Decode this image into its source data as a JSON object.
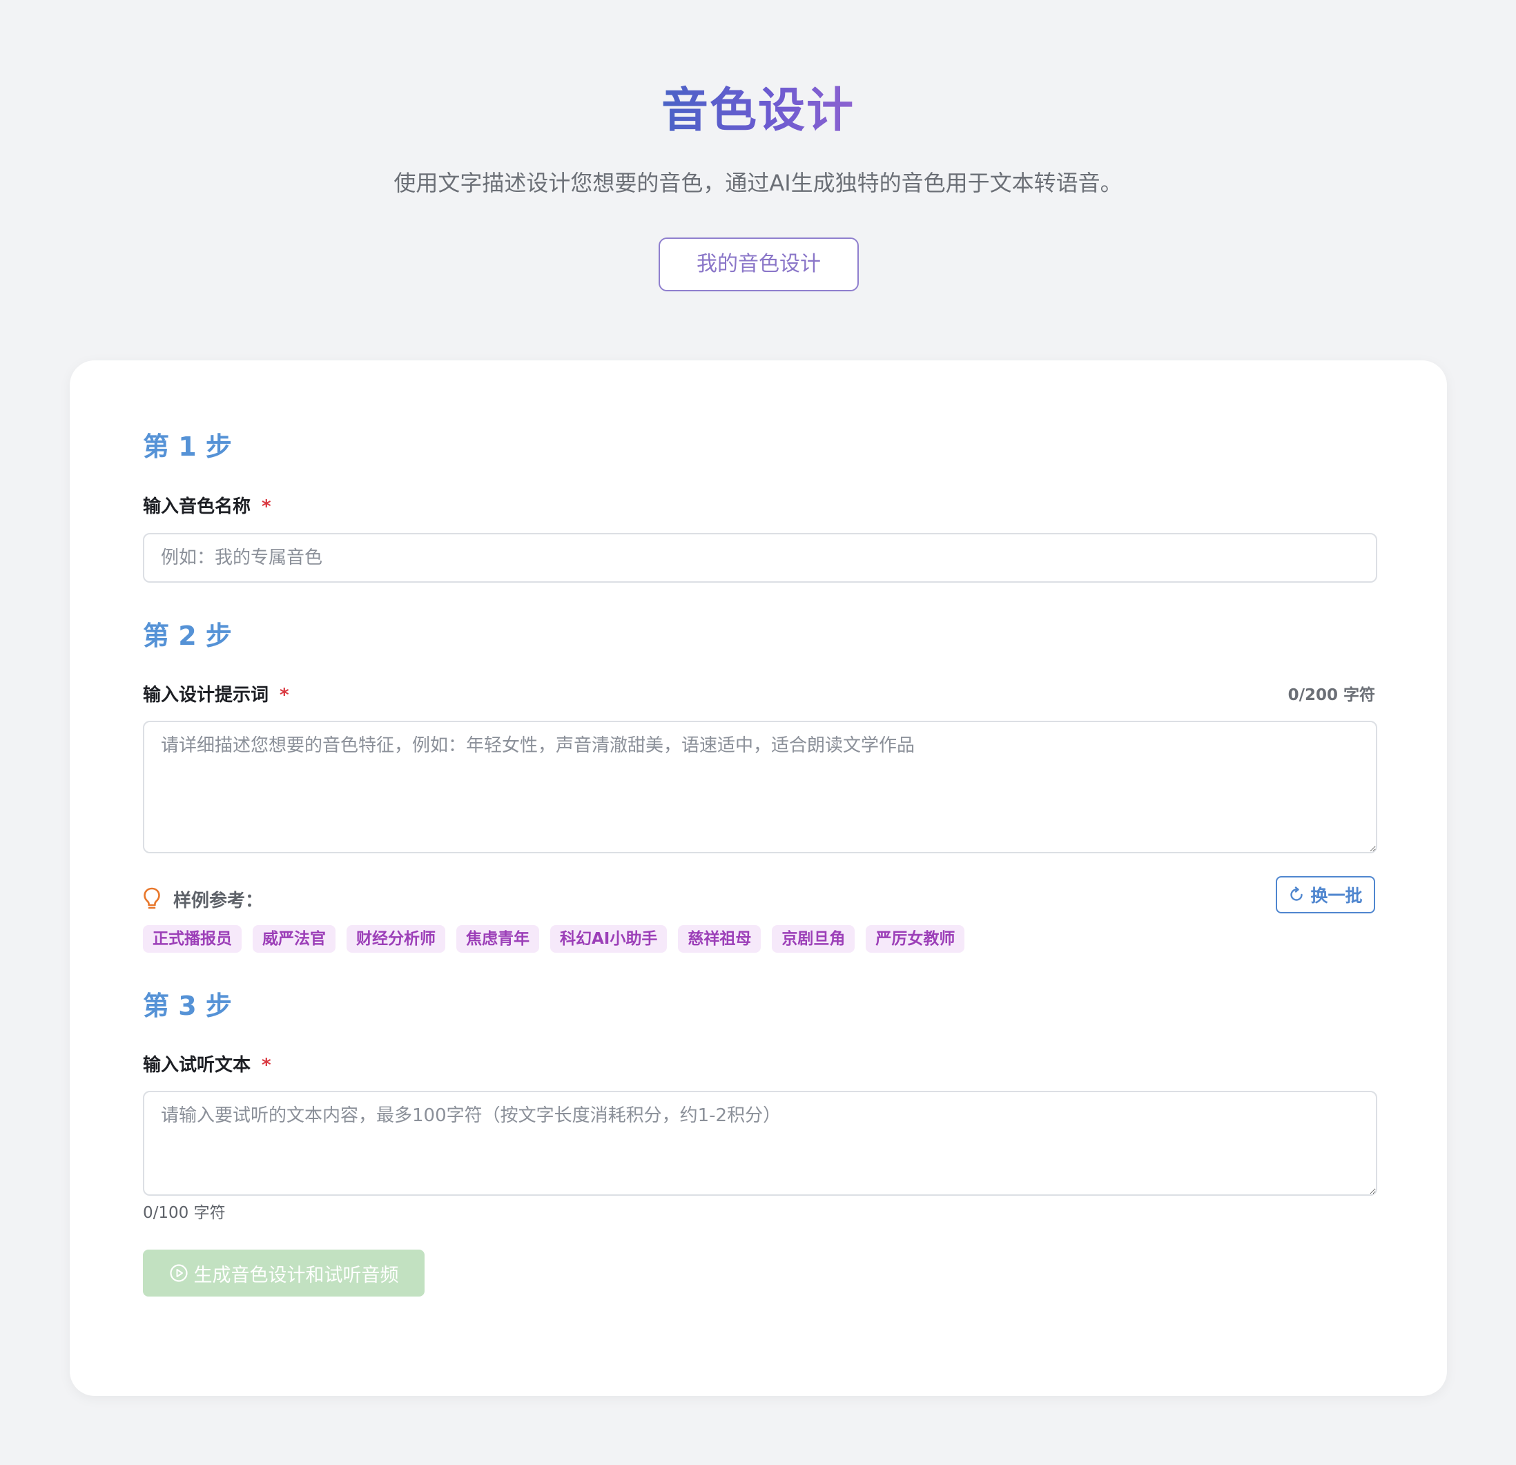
{
  "header": {
    "title": "音色设计",
    "subtitle": "使用文字描述设计您想要的音色，通过AI生成独特的音色用于文本转语音。",
    "my_designs_label": "我的音色设计"
  },
  "step1": {
    "title": "第 1 步",
    "label": "输入音色名称",
    "required_mark": "*",
    "placeholder": "例如：我的专属音色",
    "value": ""
  },
  "step2": {
    "title": "第 2 步",
    "label": "输入设计提示词",
    "required_mark": "*",
    "char_count": "0/200 字符",
    "placeholder": "请详细描述您想要的音色特征，例如：年轻女性，声音清澈甜美，语速适中，适合朗读文学作品",
    "value": "",
    "examples_label": "样例参考：",
    "refresh_label": "换一批",
    "examples": [
      "正式播报员",
      "威严法官",
      "财经分析师",
      "焦虑青年",
      "科幻AI小助手",
      "慈祥祖母",
      "京剧旦角",
      "严厉女教师"
    ]
  },
  "step3": {
    "title": "第 3 步",
    "label": "输入试听文本",
    "required_mark": "*",
    "placeholder": "请输入要试听的文本内容，最多100字符（按文字长度消耗积分，约1-2积分）",
    "value": "",
    "char_count": "0/100 字符",
    "generate_label": "生成音色设计和试听音频"
  },
  "colors": {
    "accent": "#5592d6",
    "title_gradient_start": "#4a63c6",
    "title_gradient_end": "#8c62d0",
    "required": "#d9363e",
    "tag_bg": "#f6e9fa",
    "tag_text": "#9c3fb8",
    "generate_disabled_bg": "#c2e1c1",
    "bulb": "#e8772b"
  },
  "icons": {
    "examples": "lightbulb-icon",
    "refresh": "refresh-icon",
    "generate": "play-circle-icon"
  }
}
